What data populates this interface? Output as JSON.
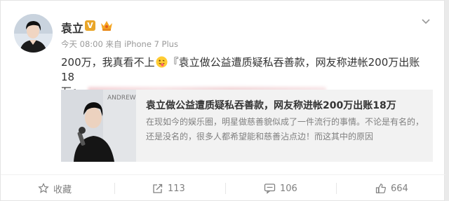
{
  "post": {
    "author": "袁立",
    "verified_badge": "V",
    "meta": "今天 08:00 来自 iPhone 7 Plus",
    "text_before_emoji": "200万，我真看不上",
    "text_after_emoji": "『袁立做公益遭质疑私吞善款，网友称进帐200万出账18",
    "text_line2": "万』",
    "emoji_icon": "tongue-face-emoji"
  },
  "preview": {
    "title": "袁立做公益遭质疑私吞善款，网友称进帐200万出账18万",
    "description": "在现如今的娱乐圈，明星做慈善貌似成了一件流行的事情。不论是有名的，还是没名的，很多人都希望能和慈善沾点边！而这其中的原因",
    "thumb_text": "ANDREW"
  },
  "actions": {
    "favorite_label": "收藏",
    "repost_count": "113",
    "comment_count": "106",
    "like_count": "664"
  },
  "colors": {
    "accent_orange": "#e9a629",
    "text_main": "#333333",
    "text_muted": "#808080"
  }
}
